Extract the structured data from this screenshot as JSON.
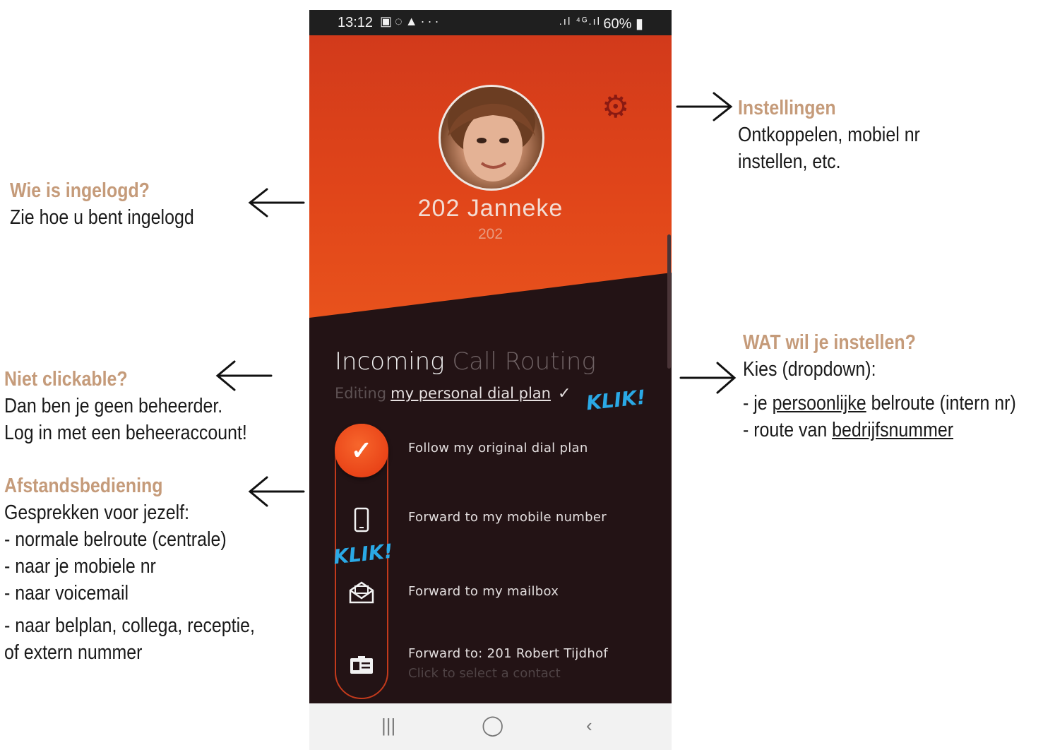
{
  "phone": {
    "status_bar": {
      "time": "13:12",
      "left_icons": [
        "image-icon",
        "whatsapp-icon",
        "alert-icon",
        "more-icon"
      ],
      "right_icons": [
        "signal-icon",
        "4g-signal-icon"
      ],
      "battery": "60%"
    },
    "profile": {
      "name": "202  Janneke",
      "extension": "202"
    },
    "routing": {
      "title_main": "Incoming",
      "title_dim": "Call Routing",
      "editing_prefix": "Editing",
      "plan": "my personal dial plan",
      "options": [
        {
          "label": "Follow my original dial plan",
          "icon": "check-icon",
          "selected": true
        },
        {
          "label": "Forward to my mobile number",
          "icon": "mobile-phone-icon"
        },
        {
          "label": "Forward to my mailbox",
          "icon": "mailbox-icon"
        },
        {
          "label": "Forward to: 201 Robert Tijdhof",
          "sublabel": "Click to select a contact",
          "icon": "contact-card-icon"
        }
      ]
    },
    "nav": [
      "recent-apps-icon",
      "home-icon",
      "back-icon"
    ]
  },
  "klik_labels": [
    "KLIK!",
    "KLIK!"
  ],
  "annotations": {
    "settings": {
      "title": "Instellingen",
      "lines": [
        "Ontkoppelen, mobiel nr",
        "instellen, etc."
      ]
    },
    "logged_in": {
      "title": "Wie is ingelogd?",
      "lines": [
        "Zie hoe u bent ingelogd"
      ]
    },
    "what_to_set": {
      "title": "WAT wil je instellen?",
      "lines": [
        "Kies (dropdown):"
      ],
      "item1_pre": "- je ",
      "item1_u": "persoonlijke",
      "item1_post": " belroute (intern nr)",
      "item2_pre": "- route van ",
      "item2_u": "bedrijfsnummer"
    },
    "not_clickable": {
      "title": "Niet clickable?",
      "lines": [
        "Dan ben je geen beheerder.",
        "Log in met een beheeraccount!"
      ]
    },
    "remote": {
      "title": "Afstandsbediening",
      "lines": [
        "Gesprekken voor jezelf:",
        "- normale belroute (centrale)",
        "- naar je mobiele nr",
        "- naar voicemail"
      ],
      "lines2": [
        "- naar belplan, collega, receptie,",
        "of extern nummer"
      ]
    }
  },
  "colors": {
    "accent_orange": "#e94418",
    "annotation_heading": "#c59b7a",
    "klik_blue": "#2aa9e6",
    "dark_bg": "#231315"
  }
}
